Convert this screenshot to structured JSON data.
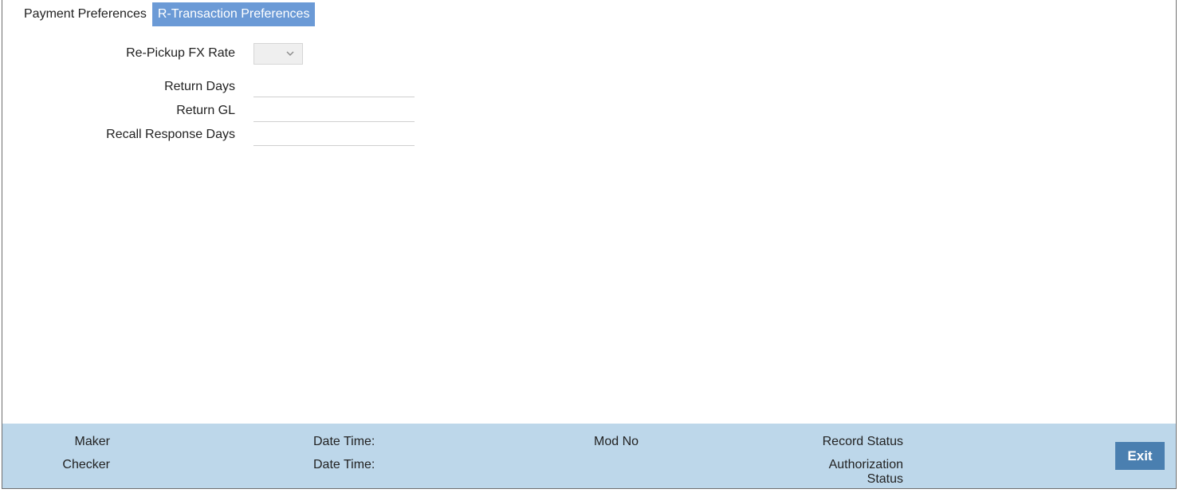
{
  "tabs": [
    {
      "label": "Payment Preferences",
      "active": false
    },
    {
      "label": "R-Transaction Preferences",
      "active": true
    }
  ],
  "form": {
    "repickup_fx_rate": {
      "label": "Re-Pickup FX Rate",
      "value": ""
    },
    "return_days": {
      "label": "Return Days",
      "value": ""
    },
    "return_gl": {
      "label": "Return GL",
      "value": ""
    },
    "recall_response_days": {
      "label": "Recall Response Days",
      "value": ""
    }
  },
  "footer": {
    "maker_label": "Maker",
    "checker_label": "Checker",
    "date_time_label_1": "Date Time:",
    "date_time_label_2": "Date Time:",
    "mod_no_label": "Mod No",
    "record_status_label": "Record Status",
    "authorization_status_label_line1": "Authorization",
    "authorization_status_label_line2": "Status",
    "exit_label": "Exit"
  },
  "colors": {
    "active_tab_bg": "#6b9ad6",
    "footer_bg": "#bdd7ea",
    "exit_button_bg": "#4a7fb0"
  },
  "icons": {
    "select_dropdown": "chevron-down-icon"
  }
}
